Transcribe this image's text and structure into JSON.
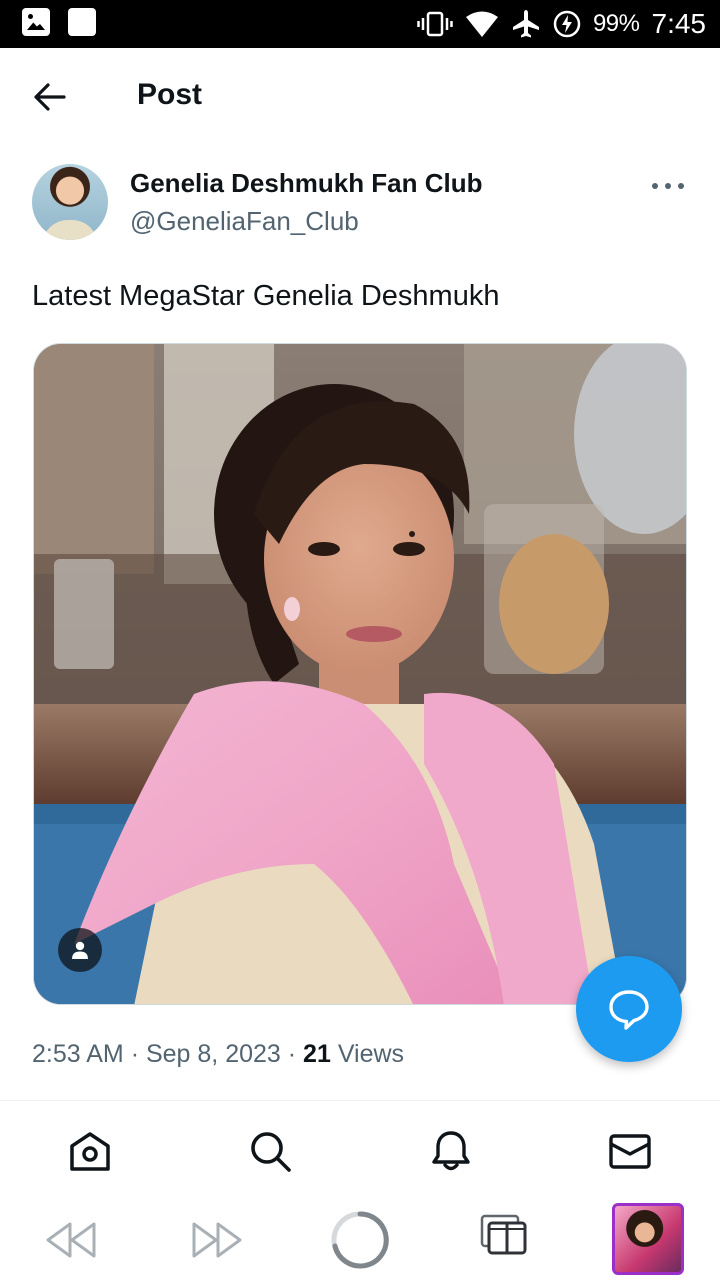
{
  "status_bar": {
    "battery": "99%",
    "time": "7:45",
    "icons": [
      "gallery-icon",
      "notification-icon",
      "vibrate-icon",
      "wifi-icon",
      "airplane-icon",
      "battery-charging-icon"
    ]
  },
  "header": {
    "title": "Post",
    "back_icon": "back-arrow-icon"
  },
  "post": {
    "author_name": "Genelia Deshmukh Fan Club",
    "author_handle": "@GeneliaFan_Club",
    "text": "Latest MegaStar Genelia Deshmukh",
    "time": "2:53 AM",
    "separator": "·",
    "date": "Sep 8, 2023",
    "views_count": "21",
    "views_label": "Views"
  },
  "bottom_nav": {
    "items": [
      "home-icon",
      "search-icon",
      "notifications-bell-icon",
      "messages-envelope-icon"
    ]
  },
  "browser_bar": {
    "items": [
      "rewind-icon",
      "fast-forward-icon",
      "loading-spinner-icon",
      "tabs-icon",
      "tab-thumbnail"
    ]
  },
  "colors": {
    "accent": "#1d9bf0",
    "text_primary": "#0f1419",
    "text_secondary": "#536471",
    "thumbnail_border": "#9b30c9"
  }
}
